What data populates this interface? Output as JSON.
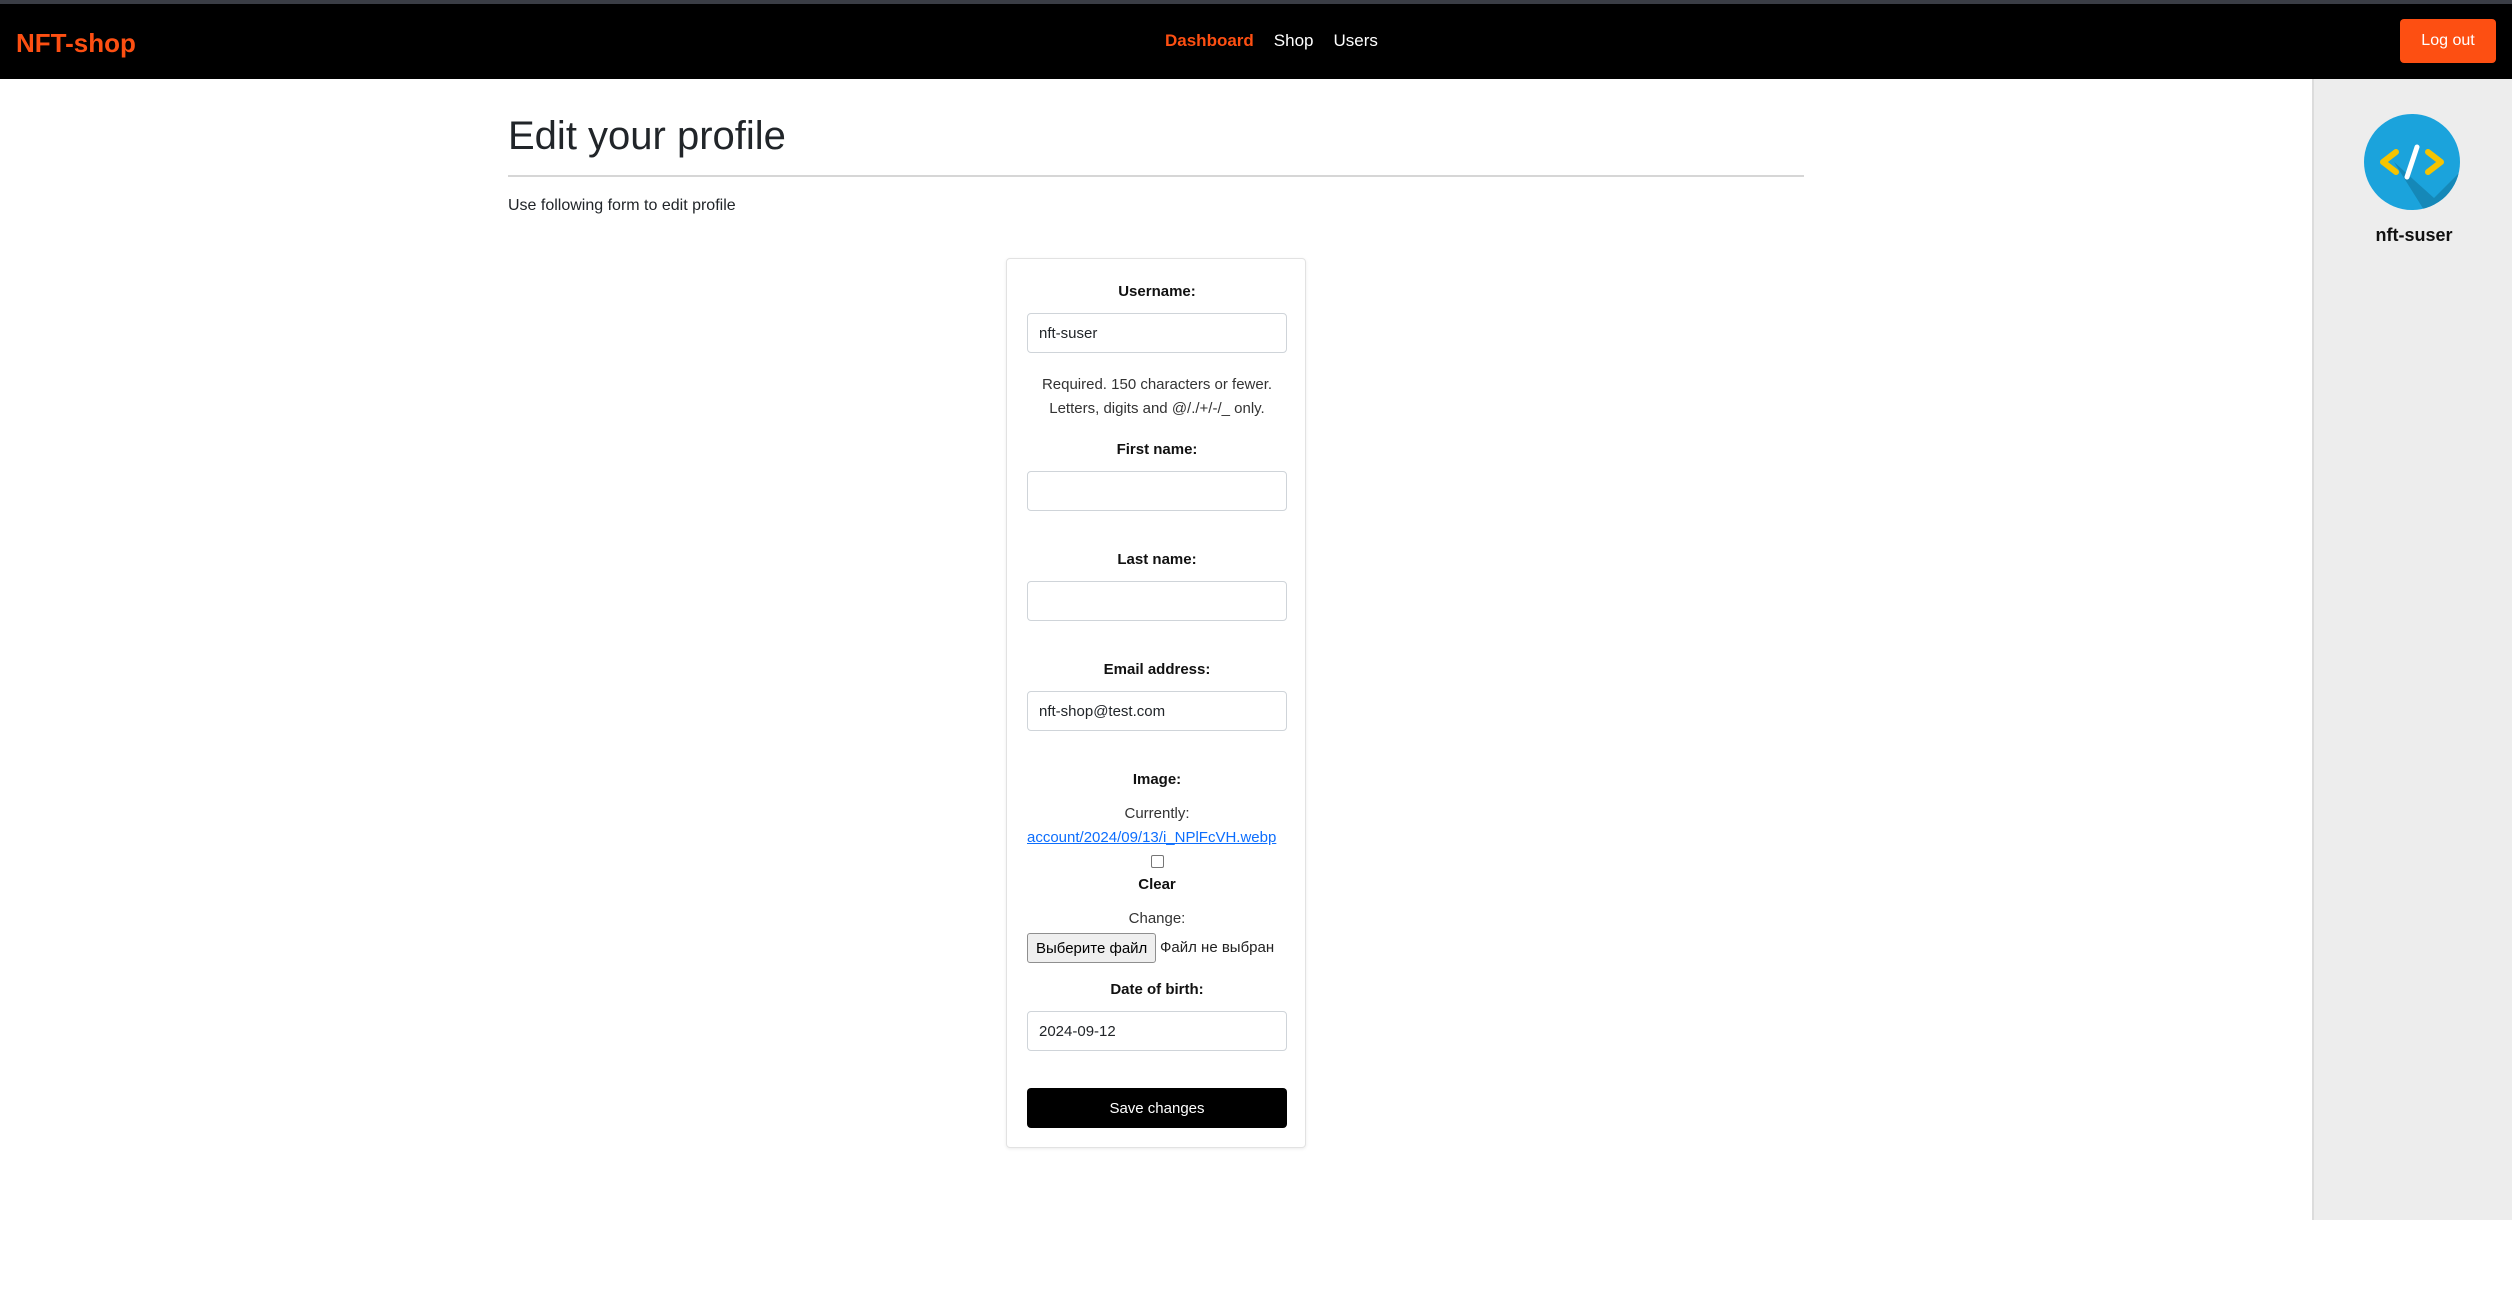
{
  "brand": "NFT-shop",
  "nav": {
    "items": [
      {
        "label": "Dashboard",
        "active": true
      },
      {
        "label": "Shop",
        "active": false
      },
      {
        "label": "Users",
        "active": false
      }
    ],
    "logout_label": "Log out"
  },
  "sidebar": {
    "avatar_icon": "code-brackets-icon",
    "username": "nft-suser"
  },
  "page": {
    "title": "Edit your profile",
    "lead": "Use following form to edit profile"
  },
  "form": {
    "username": {
      "label": "Username:",
      "value": "nft-suser",
      "help_line1": "Required. 150 characters or fewer.",
      "help_line2": "Letters, digits and @/./+/-/_ only."
    },
    "first_name": {
      "label": "First name:",
      "value": ""
    },
    "last_name": {
      "label": "Last name:",
      "value": ""
    },
    "email": {
      "label": "Email address:",
      "value": "nft-shop@test.com"
    },
    "image": {
      "label": "Image:",
      "currently_label": "Currently:",
      "current_file": "account/2024/09/13/i_NPlFcVH.webp",
      "clear_label": "Clear",
      "clear_checked": false,
      "change_label": "Change:",
      "choose_button": "Выберите файл",
      "no_file_text": "Файл не выбран"
    },
    "dob": {
      "label": "Date of birth:",
      "value": "2024-09-12"
    },
    "submit_label": "Save changes"
  },
  "colors": {
    "accent": "#fd4f12",
    "navbar_bg": "#000000",
    "sidebar_bg": "#ededed",
    "avatar_bg": "#1ba3dc",
    "avatar_brackets": "#f6c400",
    "link": "#0d6efd"
  }
}
